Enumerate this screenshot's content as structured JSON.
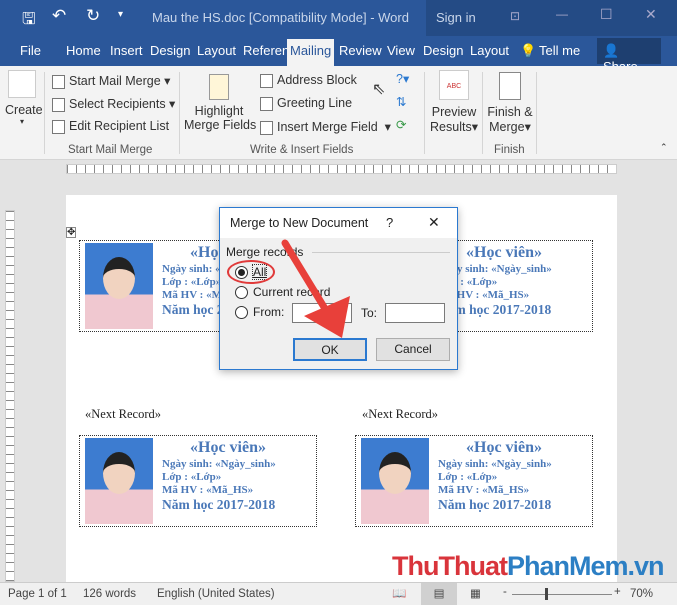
{
  "title": "Mau the HS.doc [Compatibility Mode]  -  Word",
  "sign_in": "Sign in",
  "tabs": [
    "File",
    "Home",
    "Insert",
    "Design",
    "Layout",
    "Referen",
    "Mailing",
    "Review",
    "View",
    "Design",
    "Layout"
  ],
  "tell_me": "Tell me",
  "share": "Share",
  "ribbon": {
    "create": "Create",
    "start_mail_merge": "Start Mail Merge",
    "select_recipients": "Select Recipients",
    "edit_recipient_list": "Edit Recipient List",
    "highlight1": "Highlight",
    "highlight2": "Merge Fields",
    "address_block": "Address Block",
    "greeting_line": "Greeting Line",
    "insert_merge_field": "Insert Merge Field",
    "preview1": "Preview",
    "preview2": "Results",
    "preview_icon_text": "ABC",
    "finish1": "Finish &",
    "finish2": "Merge",
    "groups": [
      "Start Mail Merge",
      "Write & Insert Fields",
      "Finish"
    ]
  },
  "card": {
    "title": "«Học  viên»",
    "l1": "Ngày sinh: «Ngày_sinh»",
    "l2": "Lớp          : «Lớp»",
    "l3": "Mã HV    : «Mã_HS»",
    "l4": "Năm học 2017-2018"
  },
  "next_record": "«Next Record»",
  "dialog": {
    "title": "Merge to New Document",
    "help": "?",
    "close": "✕",
    "group": "Merge records",
    "all": "All",
    "current": "Current record",
    "from": "From:",
    "to": "To:",
    "ok": "OK",
    "cancel": "Cancel"
  },
  "status": {
    "page": "Page 1 of 1",
    "words": "126 words",
    "lang": "English (United States)",
    "zoom": "70%"
  },
  "watermark": "ThuThuatPhanMem.vn"
}
